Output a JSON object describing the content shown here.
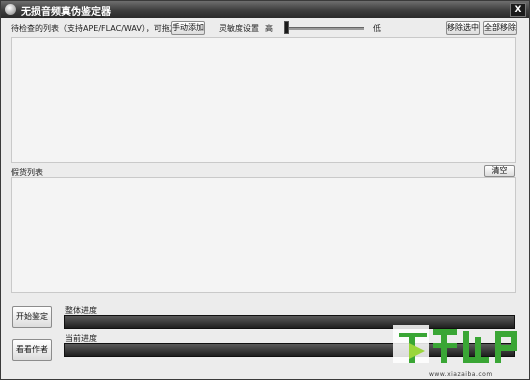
{
  "window": {
    "title": "无损音频真伪鉴定器",
    "close_glyph": "X"
  },
  "top_bar": {
    "list_label": "待检查的列表（支持APE/FLAC/WAV），可拖放",
    "add_manual_button": "手动添加",
    "sensitivity_label": "灵敏度设置",
    "high_label": "高",
    "low_label": "低",
    "sensitivity_level": 0.0,
    "remove_selected_button": "移除选中",
    "remove_all_button": "全部移除"
  },
  "fake_section": {
    "label": "假货列表",
    "clear_button": "清空"
  },
  "bottom": {
    "start_button": "开始鉴定",
    "author_button": "看看作者",
    "overall_progress_label": "整体进度",
    "overall_progress": 0,
    "current_progress_label": "当前进度",
    "current_progress": 0
  },
  "watermark": {
    "logo_text": "下载吧",
    "url": "www.xiazaiba.com"
  },
  "colors": {
    "titlebar": "#3e3e3e",
    "watermark_green": "#3aa635"
  }
}
